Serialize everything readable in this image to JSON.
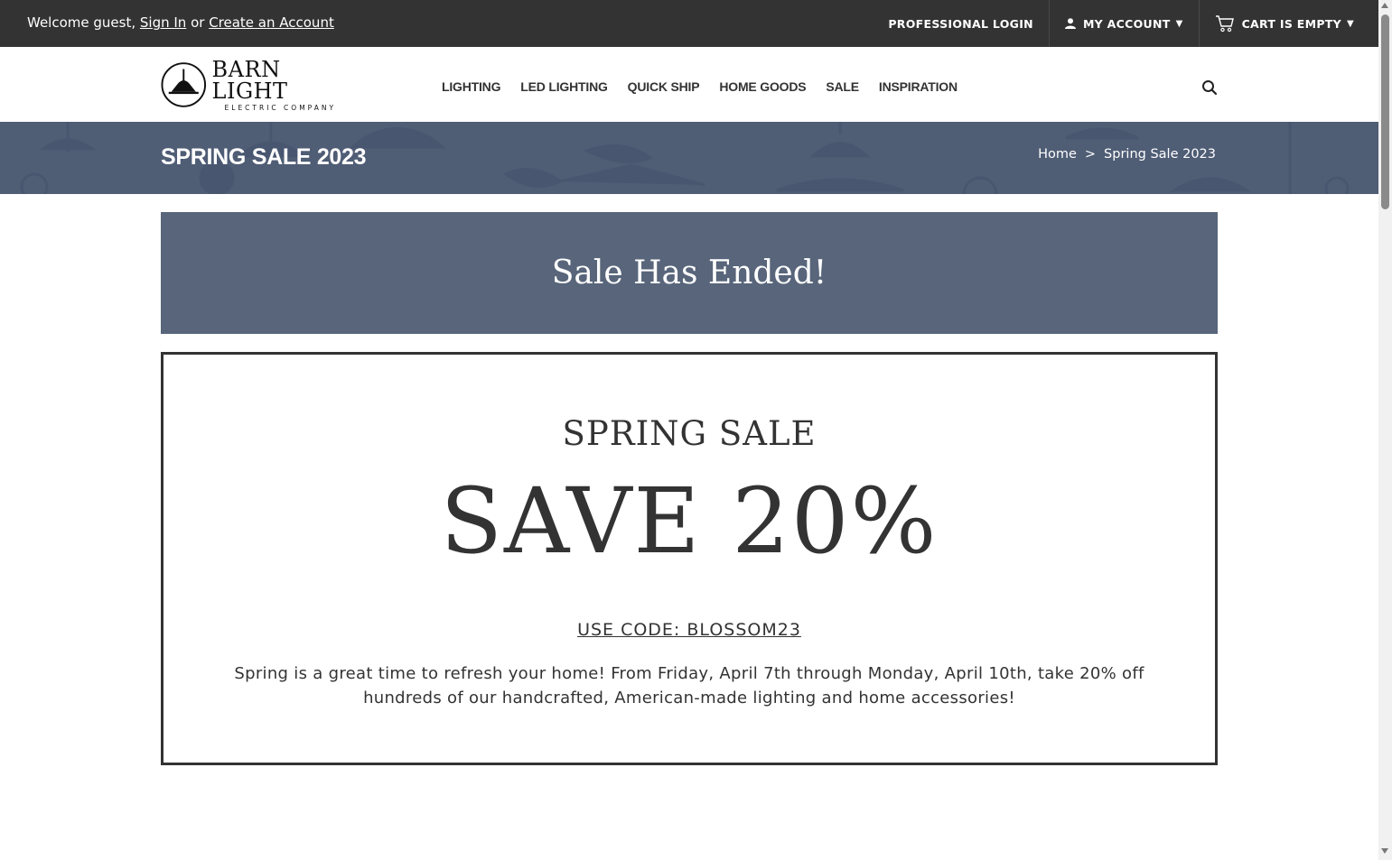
{
  "topbar": {
    "welcome_prefix": "Welcome guest, ",
    "sign_in": "Sign In",
    "or": " or ",
    "create_account": "Create an Account",
    "professional_login": "PROFESSIONAL LOGIN",
    "my_account": "MY ACCOUNT",
    "cart": "CART IS EMPTY",
    "icons": [
      "user-icon",
      "cart-icon",
      "chevron-down-icon"
    ]
  },
  "header": {
    "logo_brand": "BARN LIGHT",
    "logo_sub": "ELECTRIC COMPANY",
    "nav": [
      "LIGHTING",
      "LED LIGHTING",
      "QUICK SHIP",
      "HOME GOODS",
      "SALE",
      "INSPIRATION"
    ],
    "search_icon": "search-icon"
  },
  "page_title": "SPRING SALE 2023",
  "breadcrumb": {
    "home": "Home",
    "separator": ">",
    "current": "Spring Sale 2023"
  },
  "banner": {
    "ended": "Sale Has Ended!"
  },
  "promo": {
    "eyebrow": "SPRING SALE",
    "headline": "SAVE 20%",
    "code": "USE CODE: BLOSSOM23",
    "description": "Spring is a great time to refresh your home! From Friday, April 7th through Monday, April 10th, take 20% off hundreds of our handcrafted, American-made lighting and home accessories!"
  },
  "colors": {
    "topbar": "#333333",
    "title_banner": "#4f5d75",
    "ended_banner": "#58657a",
    "text": "#333333"
  }
}
